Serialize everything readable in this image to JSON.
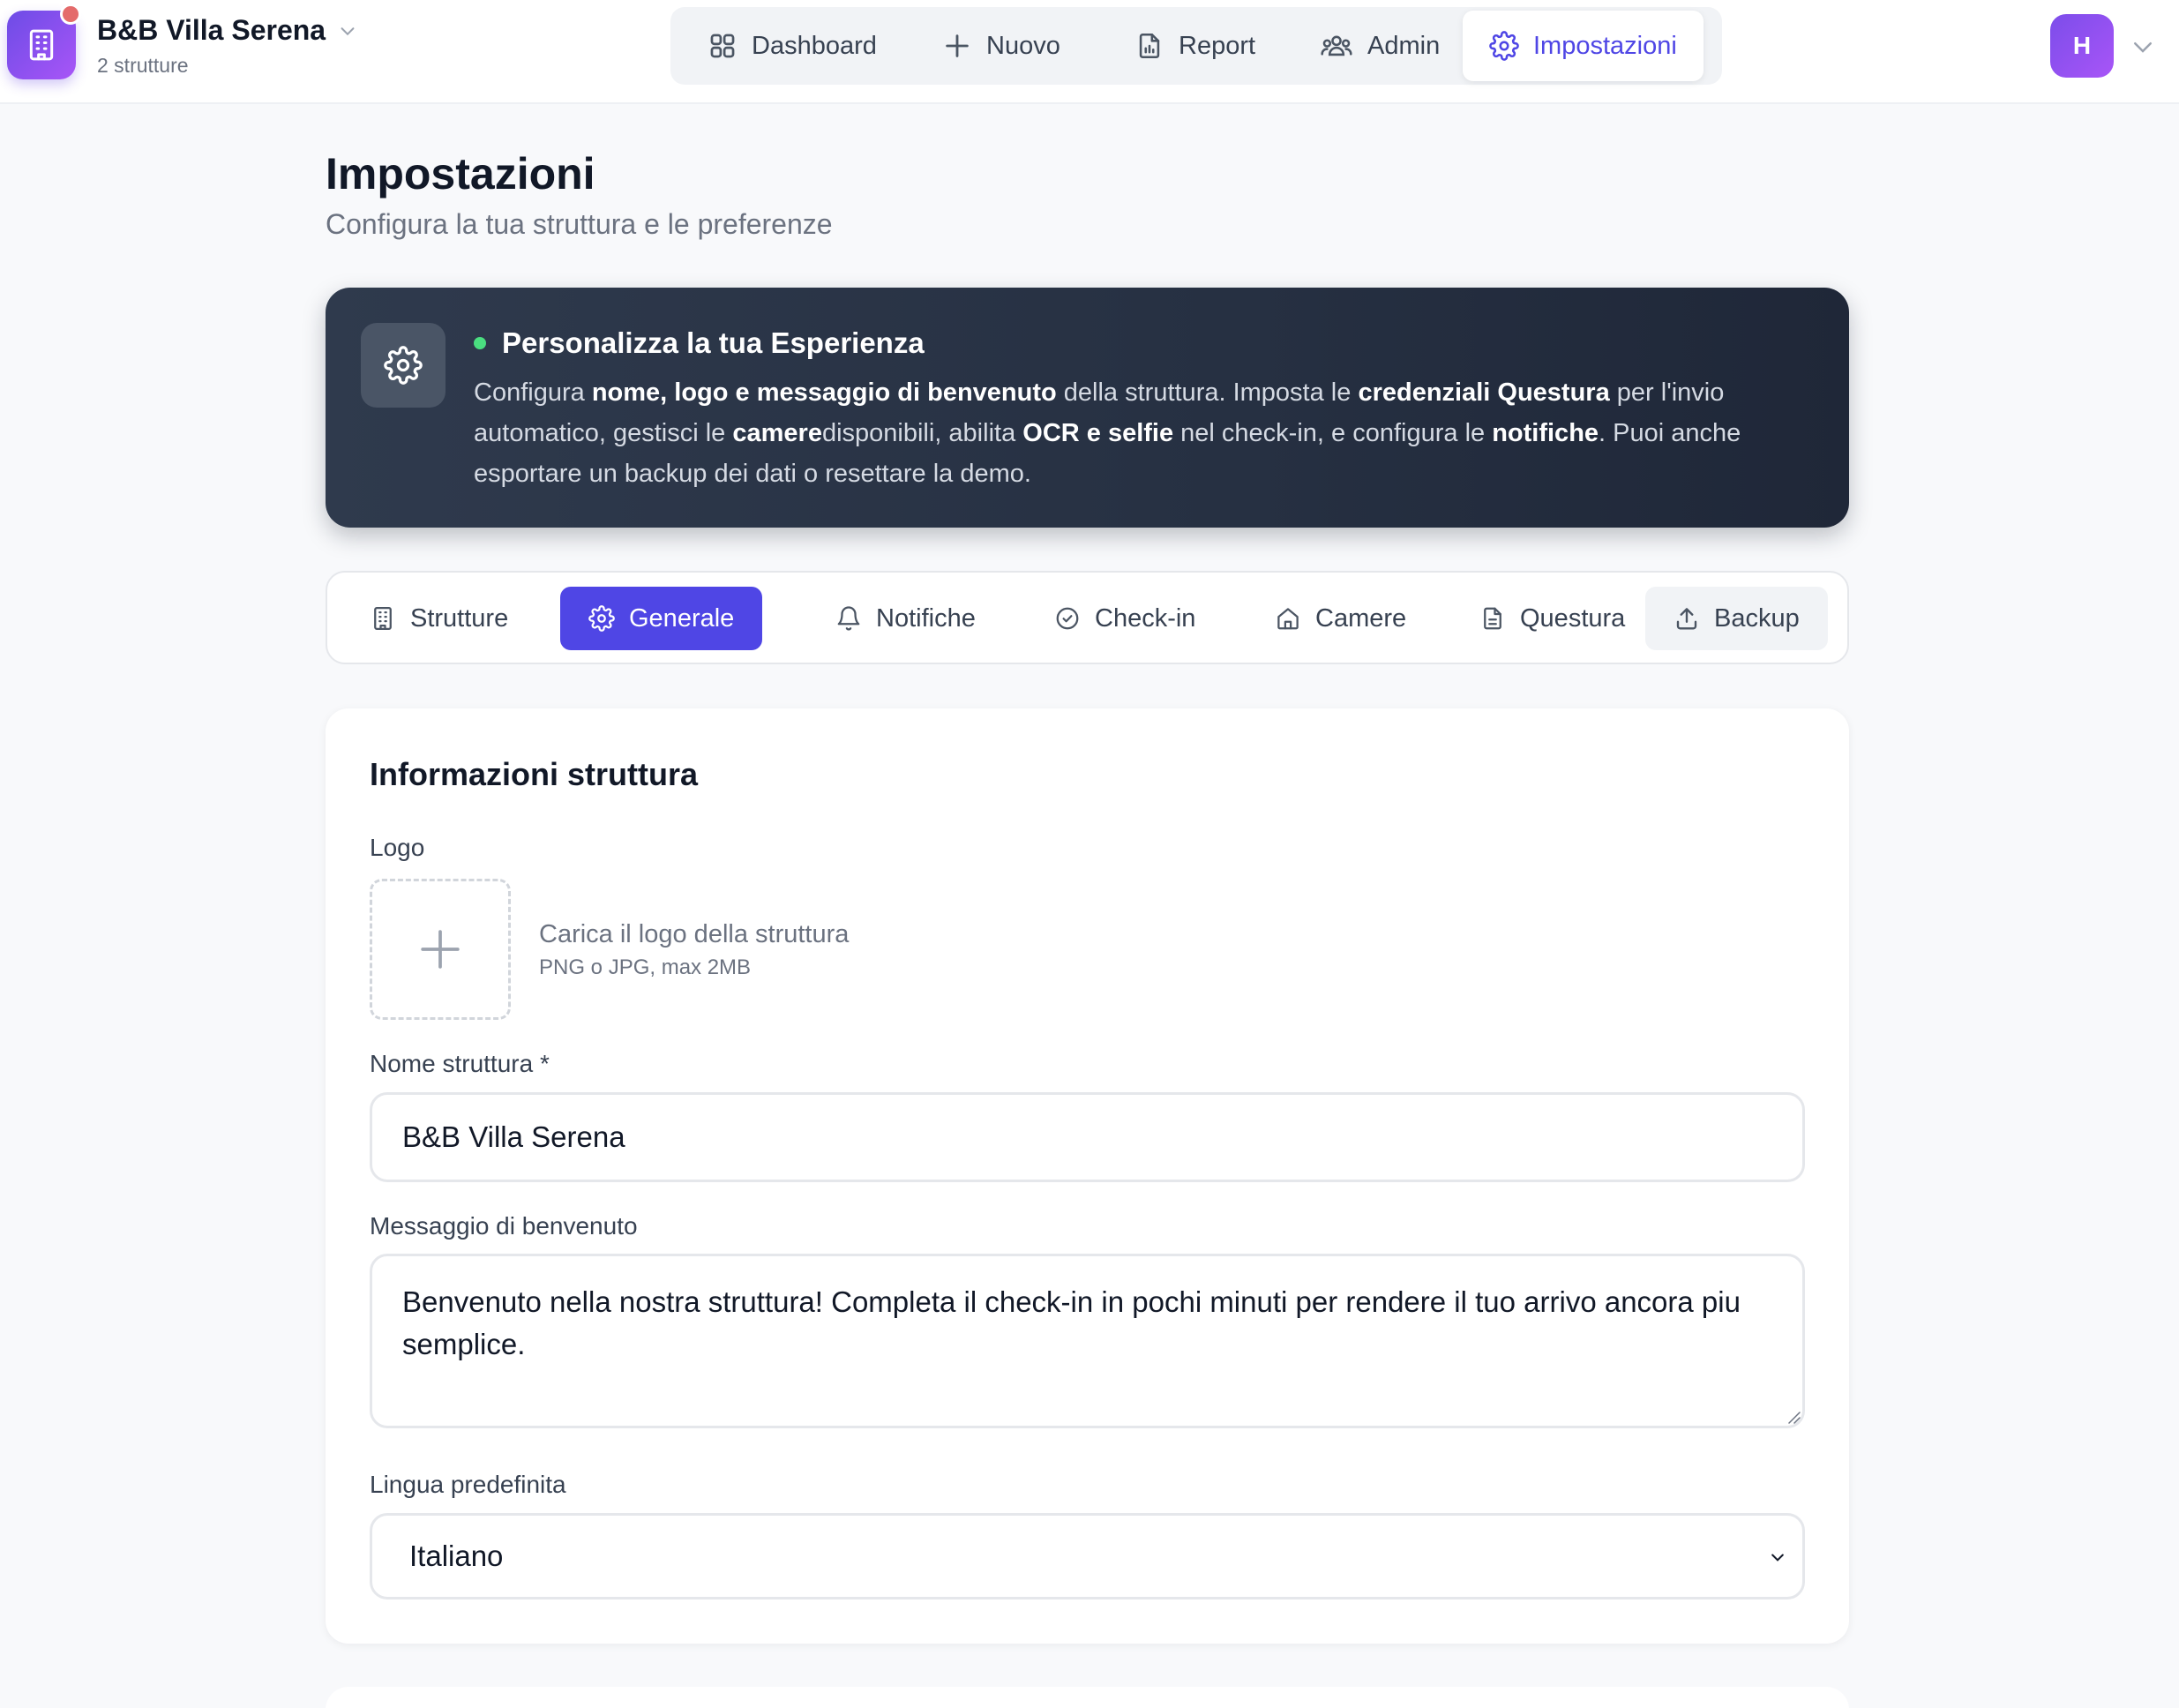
{
  "header": {
    "brand_name": "B&B Villa Serena",
    "brand_sub": "2 strutture",
    "nav": [
      {
        "label": "Dashboard",
        "icon": "grid-icon"
      },
      {
        "label": "Nuovo",
        "icon": "plus-icon"
      },
      {
        "label": "Report",
        "icon": "report-icon"
      },
      {
        "label": "Admin",
        "icon": "users-icon"
      },
      {
        "label": "Impostazioni",
        "icon": "gear-icon",
        "active": true
      }
    ],
    "avatar_initial": "H"
  },
  "page": {
    "title": "Impostazioni",
    "subtitle": "Configura la tua struttura e le preferenze"
  },
  "banner": {
    "title": "Personalizza la tua Esperienza",
    "parts": [
      {
        "t": "Configura ",
        "b": false
      },
      {
        "t": "nome, logo e messaggio di benvenuto",
        "b": true
      },
      {
        "t": " della struttura. Imposta le ",
        "b": false
      },
      {
        "t": "credenziali Questura",
        "b": true
      },
      {
        "t": " per l'invio automatico, gestisci le ",
        "b": false
      },
      {
        "t": "camere",
        "b": true
      },
      {
        "t": "disponibili, abilita ",
        "b": false
      },
      {
        "t": "OCR e selfie",
        "b": true
      },
      {
        "t": " nel check-in, e configura le ",
        "b": false
      },
      {
        "t": "notifiche",
        "b": true
      },
      {
        "t": ". Puoi anche esportare un backup dei dati o resettare la demo.",
        "b": false
      }
    ]
  },
  "tabs": [
    {
      "label": "Strutture",
      "icon": "building-icon"
    },
    {
      "label": "Generale",
      "icon": "gear-icon",
      "active": true
    },
    {
      "label": "Notifiche",
      "icon": "bell-icon"
    },
    {
      "label": "Check-in",
      "icon": "check-circle-icon"
    },
    {
      "label": "Camere",
      "icon": "home-icon"
    },
    {
      "label": "Questura",
      "icon": "document-icon"
    },
    {
      "label": "Backup",
      "icon": "upload-icon"
    }
  ],
  "form": {
    "section_title": "Informazioni struttura",
    "logo_label": "Logo",
    "logo_hint": "Carica il logo della struttura",
    "logo_hint_sub": "PNG o JPG, max 2MB",
    "name_label": "Nome struttura *",
    "name_value": "B&B Villa Serena",
    "welcome_label": "Messaggio di benvenuto",
    "welcome_value": "Benvenuto nella nostra struttura! Completa il check-in in pochi minuti per rendere il tuo arrivo ancora piu semplice.",
    "language_label": "Lingua predefinita",
    "language_value": "Italiano"
  },
  "colors": {
    "accent": "#4f46e5",
    "brand_gradient_start": "#6d4ce6",
    "brand_gradient_end": "#a855f7",
    "banner_bg": "#263042",
    "status_dot": "#4ade80",
    "notification_dot": "#e46b6b"
  }
}
